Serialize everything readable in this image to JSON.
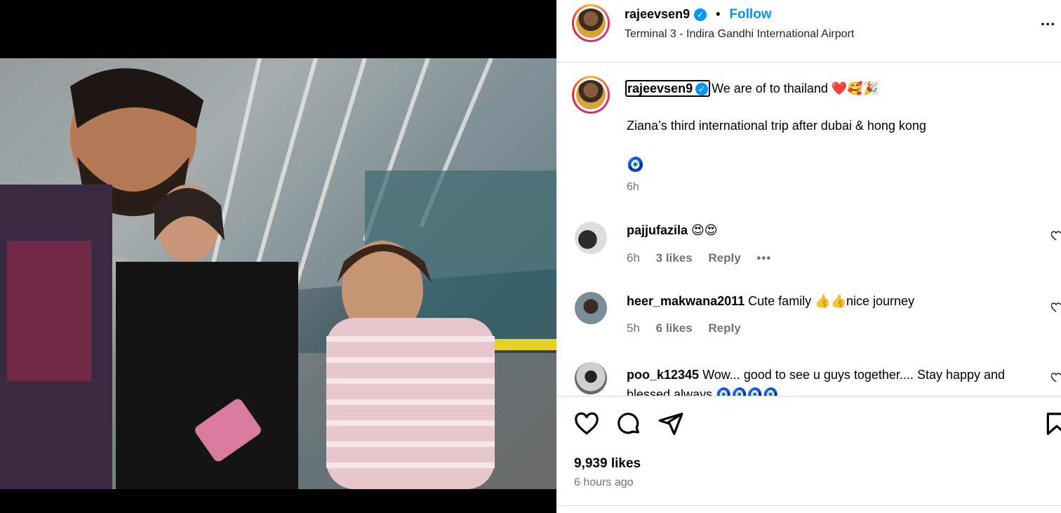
{
  "post": {
    "author": "rajeevsen9",
    "follow_label": "Follow",
    "location": "Terminal 3 - Indira Gandhi International Airport",
    "more_label": "..."
  },
  "caption": {
    "author": "rajeevsen9",
    "line1": "We are of to thailand ❤️🥰🎉",
    "line2": "Ziana’s third international trip after dubai & hong kong",
    "line3": "🧿",
    "time": "6h"
  },
  "comments": [
    {
      "user": "pajjufazila",
      "text": "😍😍",
      "time": "6h",
      "likes": "3 likes",
      "reply": "Reply",
      "more": "•••"
    },
    {
      "user": "heer_makwana2011",
      "text": "Cute family 👍👍nice journey",
      "time": "5h",
      "likes": "6 likes",
      "reply": "Reply"
    },
    {
      "user": "poo_k12345",
      "text": "Wow... good to see u guys together.... Stay happy and blessed always 🧿🧿🧿🧿",
      "time": "",
      "likes": "",
      "reply": ""
    }
  ],
  "actions": {
    "likes": "9,939 likes",
    "timestamp": "6 hours ago"
  },
  "icons": [
    "heart-icon",
    "comment-icon",
    "share-icon",
    "bookmark-icon",
    "verified-icon",
    "more-icon"
  ],
  "colors": {
    "accent": "#0095f6",
    "text": "#000000",
    "muted": "#737373"
  }
}
